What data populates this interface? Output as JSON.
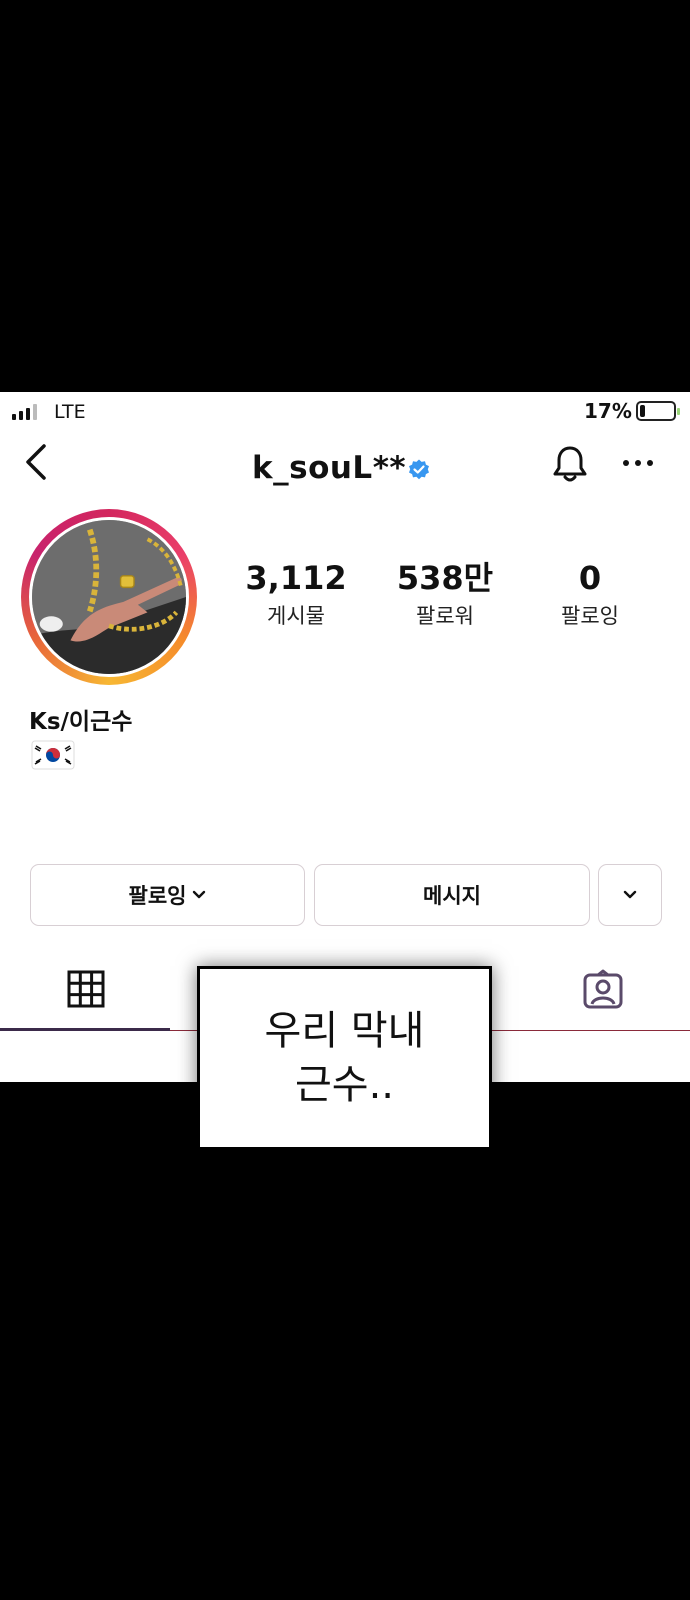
{
  "status_bar": {
    "carrier": "LTE",
    "battery_percent": "17%",
    "battery_level": 0.17
  },
  "header": {
    "username": "k_souL**",
    "verified_icon": "verified-badge-icon",
    "notification_icon": "bell-icon",
    "more_icon": "more-horizontal-icon",
    "back_icon": "chevron-left-icon"
  },
  "profile": {
    "stats": [
      {
        "value": "3,112",
        "label": "게시물"
      },
      {
        "value": "538만",
        "label": "팔로워"
      },
      {
        "value": "0",
        "label": "팔로잉"
      }
    ],
    "full_name": "Ks/이근수",
    "bio_icon": "korea-flag-icon"
  },
  "actions": {
    "follow_label": "팔로잉",
    "message_label": "메시지",
    "dropdown_icon": "chevron-down-icon"
  },
  "tabs": {
    "grid_icon": "grid-icon",
    "tagged_icon": "tagged-person-icon"
  },
  "caption": {
    "line1": "우리 막내",
    "line2": "근수.."
  },
  "colors": {
    "verified": "#3897f0",
    "ring_start": "#d3265e",
    "ring_end": "#f7b733"
  }
}
